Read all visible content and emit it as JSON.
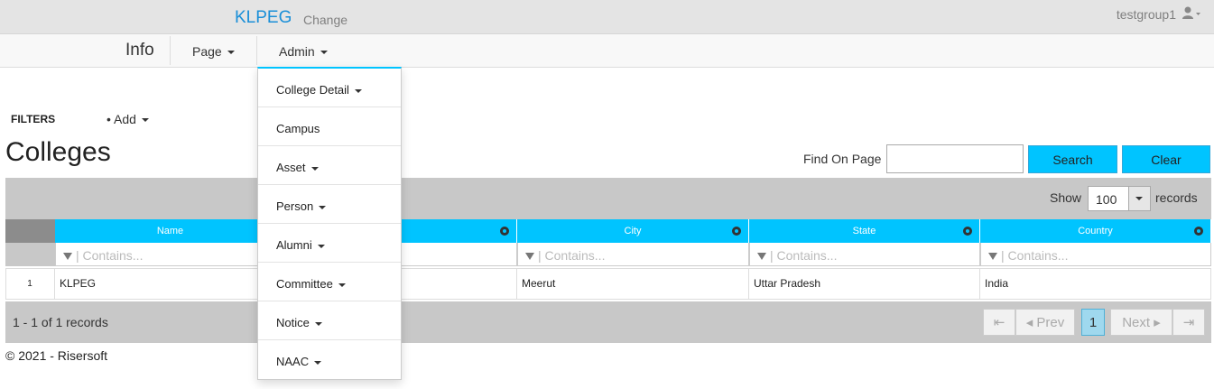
{
  "topbar": {
    "brand": "KLPEG",
    "change": "Change",
    "user": "testgroup1",
    "user_icon": "user-icon"
  },
  "nav": {
    "info": "Info",
    "page": "Page",
    "admin": "Admin"
  },
  "filters": {
    "label": "FILTERS",
    "add": "• Add"
  },
  "page": {
    "title": "Colleges"
  },
  "find": {
    "label": "Find On Page",
    "value": "",
    "search": "Search",
    "clear": "Clear"
  },
  "grid": {
    "show": "Show",
    "page_size": "100",
    "records": "records",
    "columns": [
      "Name",
      "",
      "City",
      "State",
      "Country"
    ],
    "filter_placeholder": "Contains...",
    "rows": [
      {
        "num": "1",
        "name": "KLPEG",
        "city": "Meerut",
        "state": "Uttar Pradesh",
        "country": "India"
      }
    ],
    "footer": "1 - 1 of 1 records",
    "pager": {
      "first": "⇤",
      "prev": "◂ Prev",
      "current": "1",
      "next": "Next ▸",
      "last": "⇥"
    }
  },
  "copyright": "© 2021 - Risersoft",
  "admin_menu": [
    {
      "label": "College Detail",
      "has_caret": true
    },
    {
      "label": "Campus",
      "has_caret": false
    },
    {
      "label": "Asset",
      "has_caret": true
    },
    {
      "label": "Person",
      "has_caret": true
    },
    {
      "label": "Alumni",
      "has_caret": true
    },
    {
      "label": "Committee",
      "has_caret": true
    },
    {
      "label": "Notice",
      "has_caret": true
    },
    {
      "label": "NAAC",
      "has_caret": true
    }
  ],
  "colors": {
    "accent": "#00c4ff",
    "brand": "#1a8fd8"
  }
}
